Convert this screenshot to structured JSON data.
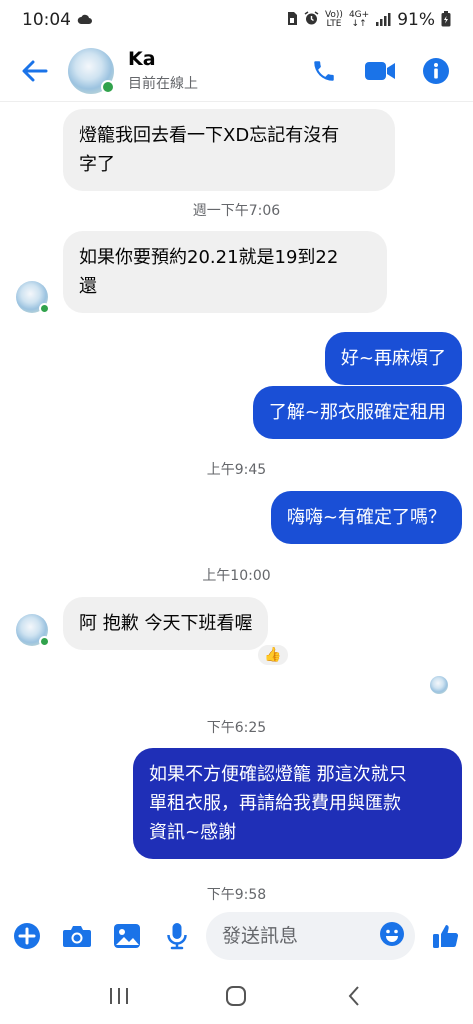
{
  "status_bar": {
    "time": "10:04",
    "volte_top": "Vo))",
    "volte_bottom": "LTE",
    "network_top": "4G+",
    "network_bottom": "↓↑",
    "battery": "91%"
  },
  "header": {
    "name": "Ka",
    "status": "目前在線上"
  },
  "messages": [
    {
      "direction": "in",
      "lines": [
        "燈籠我回去看一下XD忘記有沒有",
        "字了"
      ]
    },
    {
      "timestamp": "週一下午7:06"
    },
    {
      "direction": "in",
      "lines": [
        "如果你要預約20.21就是19到22",
        "還"
      ]
    },
    {
      "direction": "out",
      "lines": [
        "好~再麻煩了"
      ]
    },
    {
      "direction": "out",
      "lines": [
        "了解~那衣服確定租用"
      ]
    },
    {
      "timestamp": "上午9:45"
    },
    {
      "direction": "out",
      "lines": [
        "嗨嗨~有確定了嗎？"
      ]
    },
    {
      "timestamp": "上午10:00"
    },
    {
      "direction": "in",
      "lines": [
        "阿 抱歉 今天下班看喔"
      ],
      "reaction": "👍"
    },
    {
      "timestamp": "下午6:25"
    },
    {
      "direction": "out",
      "lines": [
        "如果不方便確認燈籠 那這次就只",
        "單租衣服，再請給我費用與匯款",
        "資訊~感謝"
      ]
    },
    {
      "timestamp": "下午9:58"
    }
  ],
  "composer": {
    "placeholder": "發送訊息"
  },
  "colors": {
    "accent": "#1a73e8",
    "outgoing_bubble": "#1a4fd6",
    "outgoing_bubble_dark": "#1f2fb7",
    "incoming_bubble": "#f0f0f0",
    "online": "#31a24c"
  }
}
